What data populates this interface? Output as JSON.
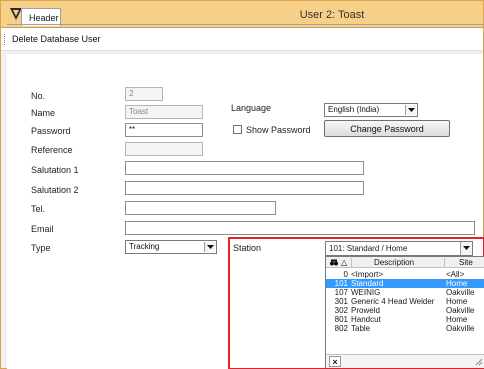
{
  "window": {
    "title": "User 2: Toast"
  },
  "toolbar": {
    "delete_label": "Delete Database User"
  },
  "tabs": [
    {
      "label": "Header"
    }
  ],
  "form": {
    "no": {
      "label": "No.",
      "value": "2"
    },
    "name": {
      "label": "Name",
      "value": "Toast"
    },
    "password": {
      "label": "Password",
      "value": "**"
    },
    "reference": {
      "label": "Reference",
      "value": ""
    },
    "salutation1": {
      "label": "Salutation 1",
      "value": ""
    },
    "salutation2": {
      "label": "Salutation 2",
      "value": ""
    },
    "tel": {
      "label": "Tel.",
      "value": ""
    },
    "email": {
      "label": "Email",
      "value": ""
    },
    "type": {
      "label": "Type",
      "value": "Tracking"
    },
    "language": {
      "label": "Language",
      "value": "English (India)"
    },
    "show_password": {
      "label": "Show Password",
      "checked": false
    },
    "change_password": {
      "label": "Change Password"
    },
    "station": {
      "label": "Station",
      "value": "101: Standard / Home"
    }
  },
  "station_dropdown": {
    "columns": {
      "code": "△",
      "description": "Description",
      "site": "Site"
    },
    "rows": [
      {
        "code": "0",
        "description": "<Import>",
        "site": "<All>",
        "selected": false
      },
      {
        "code": "101",
        "description": "Standard",
        "site": "Home",
        "selected": true
      },
      {
        "code": "107",
        "description": "WEINIG",
        "site": "Oakville",
        "selected": false
      },
      {
        "code": "301",
        "description": "Generic 4 Head Welder",
        "site": "Home",
        "selected": false
      },
      {
        "code": "302",
        "description": "Proweld",
        "site": "Oakville",
        "selected": false
      },
      {
        "code": "801",
        "description": "Handcut",
        "site": "Home",
        "selected": false
      },
      {
        "code": "802",
        "description": "Table",
        "site": "Oakville",
        "selected": false
      }
    ],
    "close_label": "×"
  },
  "colors": {
    "titlebar": "#f6d089",
    "selection": "#3399ff",
    "highlight": "#e4222a"
  }
}
